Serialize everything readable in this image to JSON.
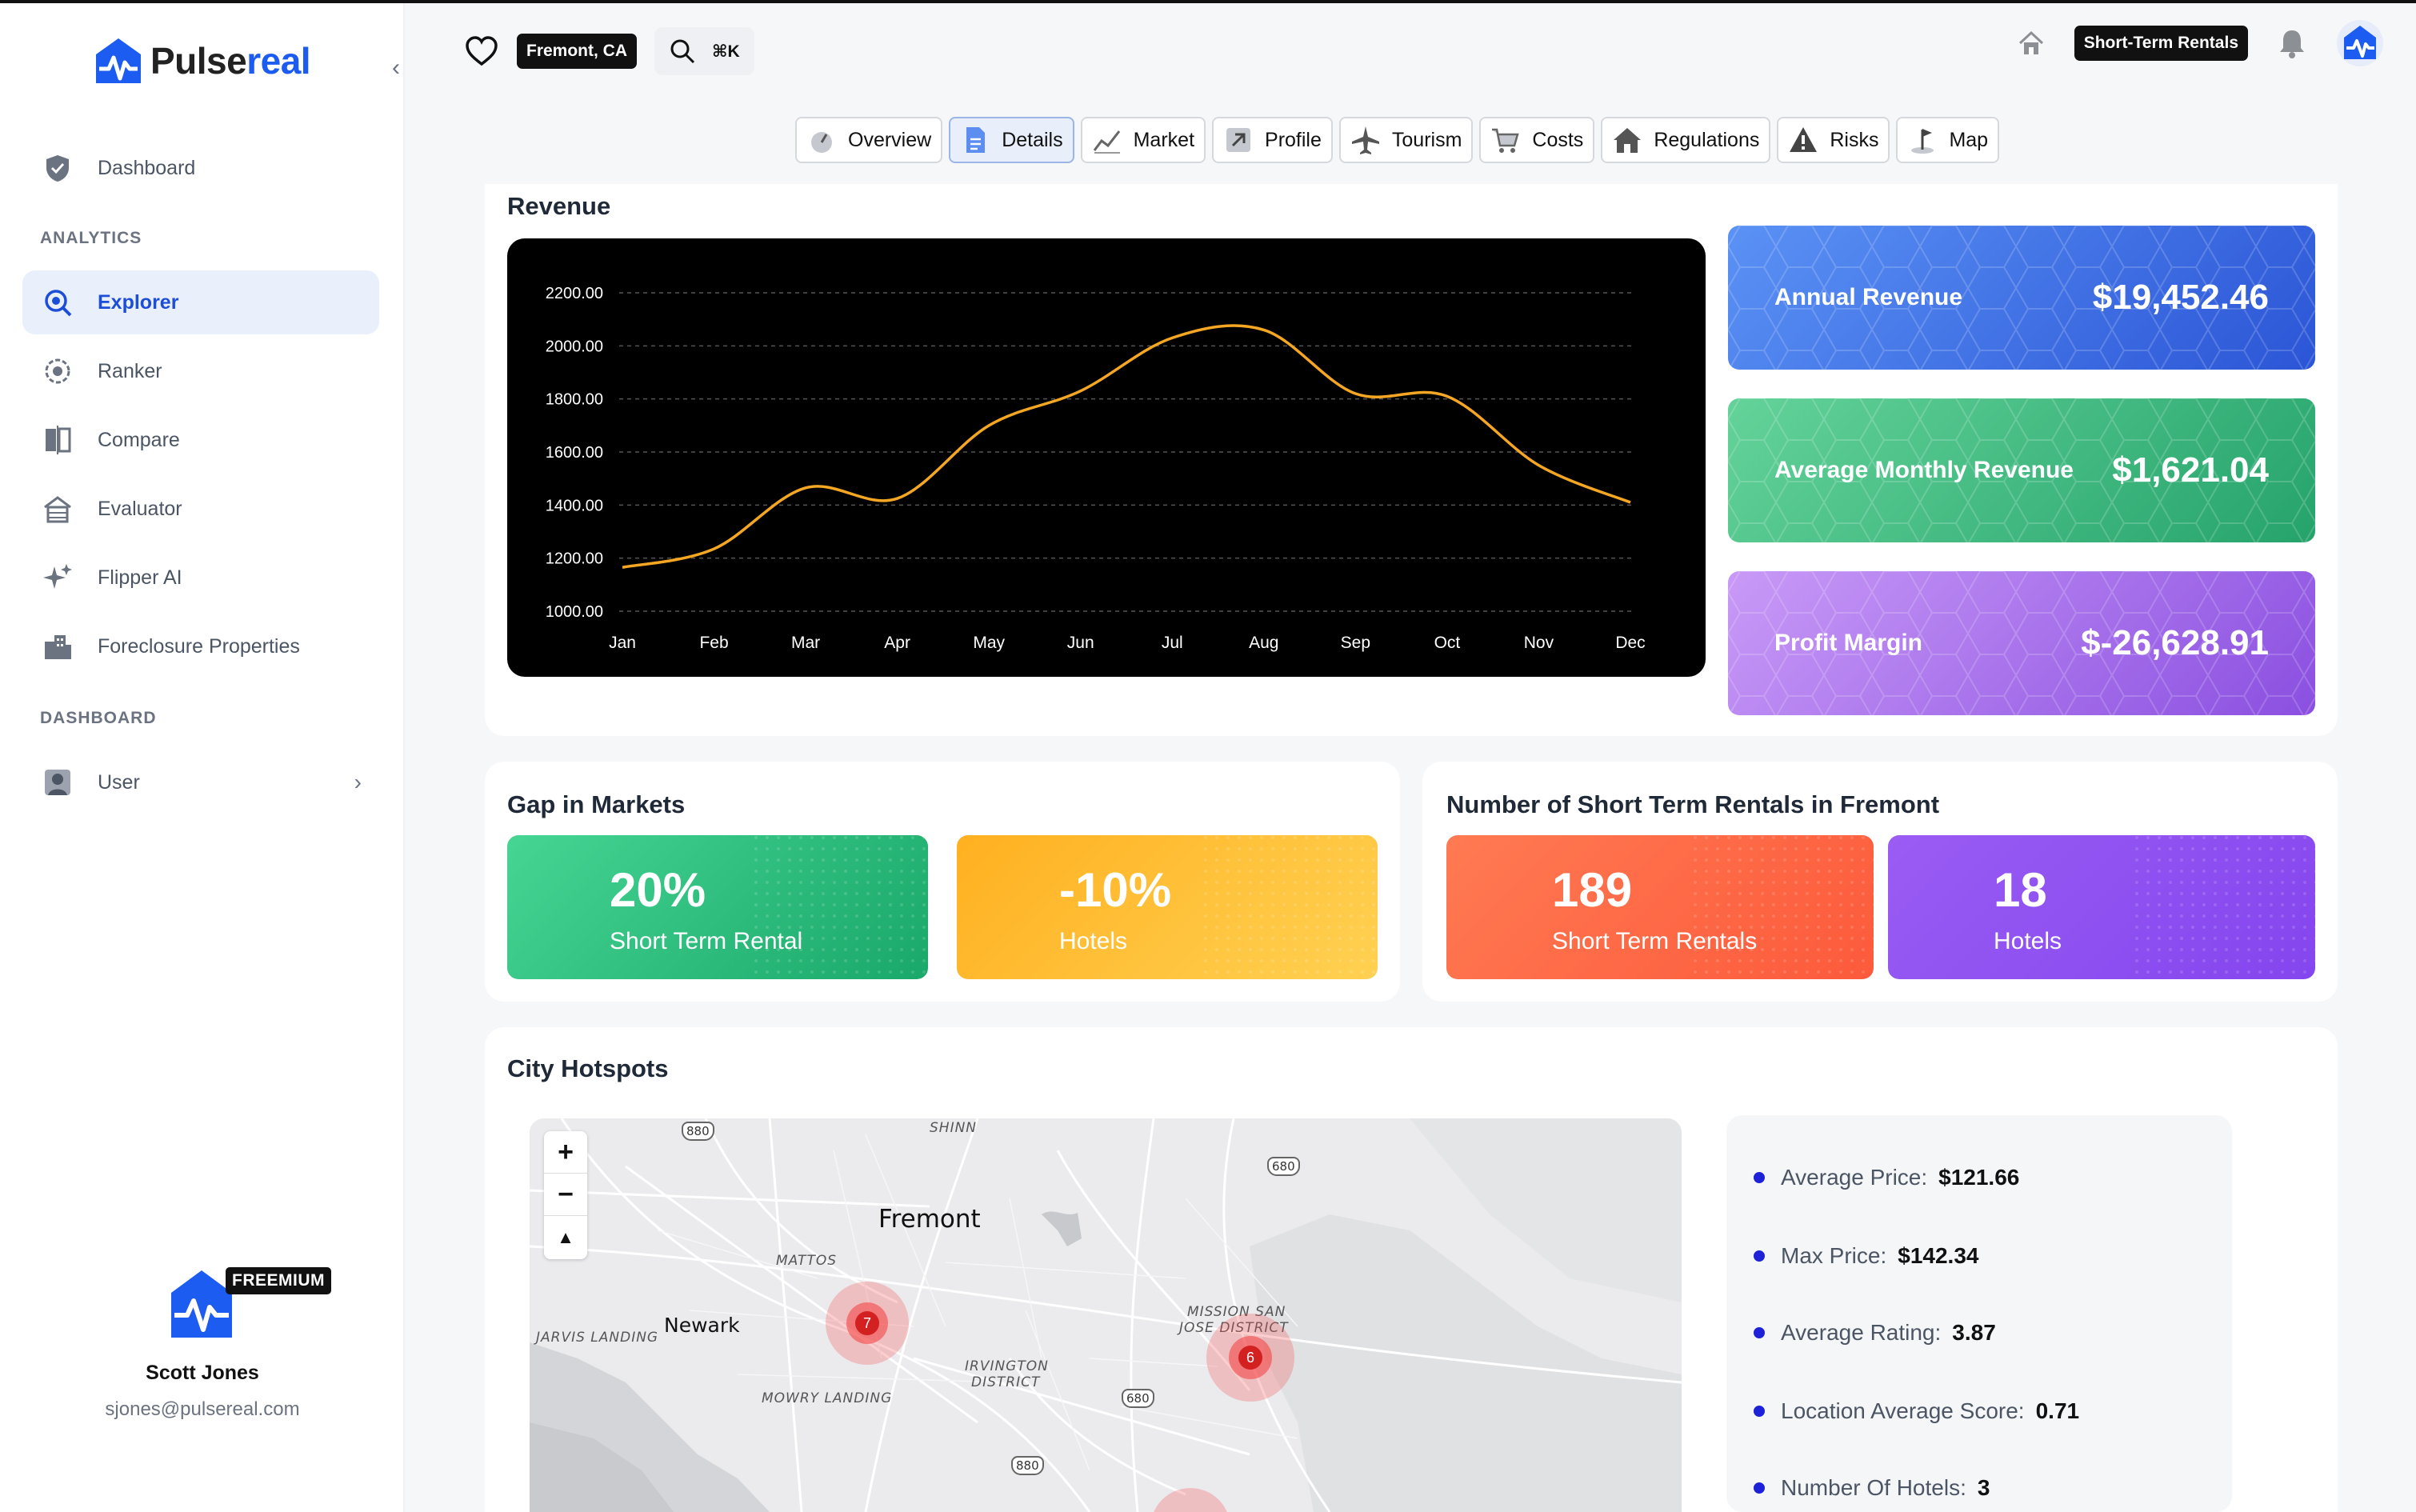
{
  "brand": {
    "name_dark": "Pulse",
    "name_blue": "real",
    "accent": "#1d5cf0"
  },
  "sidebar": {
    "items": [
      {
        "label": "Dashboard",
        "icon": "shield-check-icon"
      },
      {
        "label": "Explorer",
        "icon": "search-globe-icon",
        "active": true
      },
      {
        "label": "Ranker",
        "icon": "target-icon"
      },
      {
        "label": "Compare",
        "icon": "compare-icon"
      },
      {
        "label": "Evaluator",
        "icon": "house-scale-icon"
      },
      {
        "label": "Flipper AI",
        "icon": "sparkles-icon"
      },
      {
        "label": "Foreclosure Properties",
        "icon": "buildings-icon"
      },
      {
        "label": "User",
        "icon": "user-icon"
      }
    ],
    "section_analytics": "ANALYTICS",
    "section_dashboard": "DASHBOARD",
    "profile": {
      "badge": "FREEMIUM",
      "name": "Scott Jones",
      "email": "sjones@pulsereal.com"
    }
  },
  "topbar": {
    "location": "Fremont, CA",
    "shortcut": "⌘K",
    "mode": "Short-Term Rentals"
  },
  "tabs": [
    {
      "label": "Overview",
      "icon": "gauge-icon"
    },
    {
      "label": "Details",
      "icon": "document-icon",
      "active": true
    },
    {
      "label": "Market",
      "icon": "chart-line-icon"
    },
    {
      "label": "Profile",
      "icon": "arrow-up-right-icon"
    },
    {
      "label": "Tourism",
      "icon": "airplane-icon"
    },
    {
      "label": "Costs",
      "icon": "cart-icon"
    },
    {
      "label": "Regulations",
      "icon": "house-icon"
    },
    {
      "label": "Risks",
      "icon": "warning-icon"
    },
    {
      "label": "Map",
      "icon": "map-pin-icon"
    }
  ],
  "revenue": {
    "title": "Revenue",
    "stats": [
      {
        "label": "Annual Revenue",
        "value": "$19,452.46",
        "color_from": "#5b92f5",
        "color_to": "#2b55d6"
      },
      {
        "label": "Average Monthly Revenue",
        "value": "$1,621.04",
        "color_from": "#64d39a",
        "color_to": "#25a36b"
      },
      {
        "label": "Profit Margin",
        "value": "$-26,628.91",
        "color_from": "#c99af7",
        "color_to": "#8a4fe0"
      }
    ]
  },
  "chart_data": {
    "type": "line",
    "title": "",
    "xlabel": "",
    "ylabel": "",
    "categories": [
      "Jan",
      "Feb",
      "Mar",
      "Apr",
      "May",
      "Jun",
      "Jul",
      "Aug",
      "Sep",
      "Oct",
      "Nov",
      "Dec"
    ],
    "values": [
      1165,
      1235,
      1465,
      1425,
      1700,
      1830,
      2030,
      2060,
      1820,
      1810,
      1550,
      1410
    ],
    "y_ticks": [
      "2200.00",
      "2000.00",
      "1800.00",
      "1600.00",
      "1400.00",
      "1200.00",
      "1000.00"
    ],
    "ylim": [
      1000,
      2200
    ],
    "line_color": "#f5a623",
    "background": "#000000",
    "grid": true
  },
  "gap": {
    "title": "Gap in Markets",
    "tiles": [
      {
        "value": "20%",
        "label": "Short Term Rental"
      },
      {
        "value": "-10%",
        "label": "Hotels"
      }
    ]
  },
  "rentals": {
    "title": "Number of Short Term Rentals in Fremont",
    "tiles": [
      {
        "value": "189",
        "label": "Short Term Rentals"
      },
      {
        "value": "18",
        "label": "Hotels"
      }
    ]
  },
  "hotspots": {
    "title": "City Hotspots",
    "map": {
      "labels": [
        "Fremont",
        "Newark",
        "SHINN",
        "MATTOS",
        "JARVIS LANDING",
        "IRVINGTON",
        "DISTRICT",
        "MISSION SAN",
        "JOSE DISTRICT",
        "MOWRY LANDING"
      ],
      "highways": [
        "880",
        "680",
        "680",
        "880"
      ],
      "clusters": [
        {
          "count": "7"
        },
        {
          "count": "6"
        }
      ]
    },
    "stats": [
      {
        "label": "Average Price:",
        "value": "$121.66"
      },
      {
        "label": "Max Price:",
        "value": "$142.34"
      },
      {
        "label": "Average Rating:",
        "value": "3.87"
      },
      {
        "label": "Location Average Score:",
        "value": "0.71"
      },
      {
        "label": "Number Of Hotels:",
        "value": "3"
      }
    ]
  }
}
